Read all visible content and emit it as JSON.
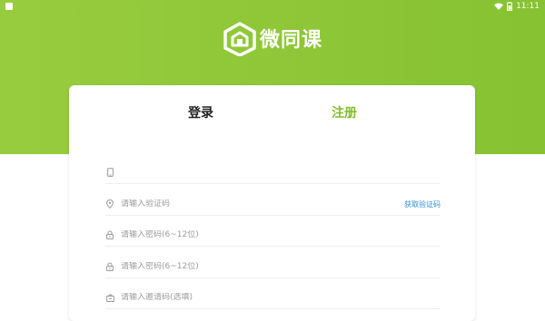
{
  "status_bar": {
    "time": "11:11",
    "icons": [
      "app-icon",
      "wifi-icon",
      "battery-icon"
    ]
  },
  "logo": {
    "text": "微同课",
    "icon": "house-logo-icon"
  },
  "colors": {
    "brand_green": "#8bc53a",
    "active_tab": "#7fbc2b",
    "link_blue": "#2f8fe0"
  },
  "tabs": [
    {
      "label": "登录",
      "active": false
    },
    {
      "label": "注册",
      "active": true
    }
  ],
  "form": {
    "phone": {
      "icon": "phone-icon",
      "value": "",
      "placeholder": ""
    },
    "code": {
      "icon": "location-icon",
      "value": "",
      "placeholder": "请输入验证码",
      "action": "获取验证码"
    },
    "password": {
      "icon": "lock-icon",
      "value": "",
      "placeholder": "请输入密码(6~12位)"
    },
    "confirm_password": {
      "icon": "lock-icon",
      "value": "",
      "placeholder": "请输入密码(6~12位)"
    },
    "invite_code": {
      "icon": "invite-icon",
      "value": "",
      "placeholder": "请输入邀请码(选填)"
    }
  }
}
